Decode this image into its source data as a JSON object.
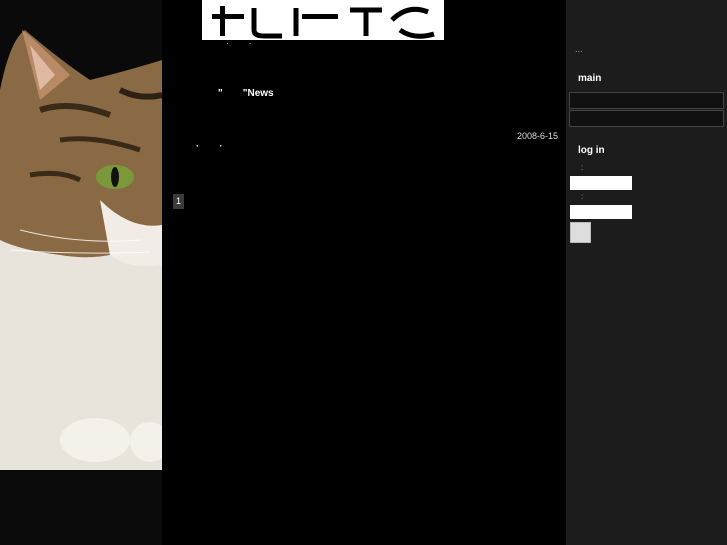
{
  "header": {
    "logo_dots": "· ·"
  },
  "main": {
    "news_open_quote": "\"",
    "news_title": "\"News",
    "entry_date": "2008-6-15",
    "entry_dots": "· ·",
    "pagination_current": "1"
  },
  "sidebar": {
    "top_ellipsis": "...",
    "main_heading": "main",
    "login_heading": "log in",
    "username_colon": ":",
    "password_colon": ":"
  },
  "colors": {
    "page_bg": "#000000",
    "sidebar_bg": "#1c1c1c",
    "logo_bg": "#ffffff",
    "text": "#ffffff"
  }
}
